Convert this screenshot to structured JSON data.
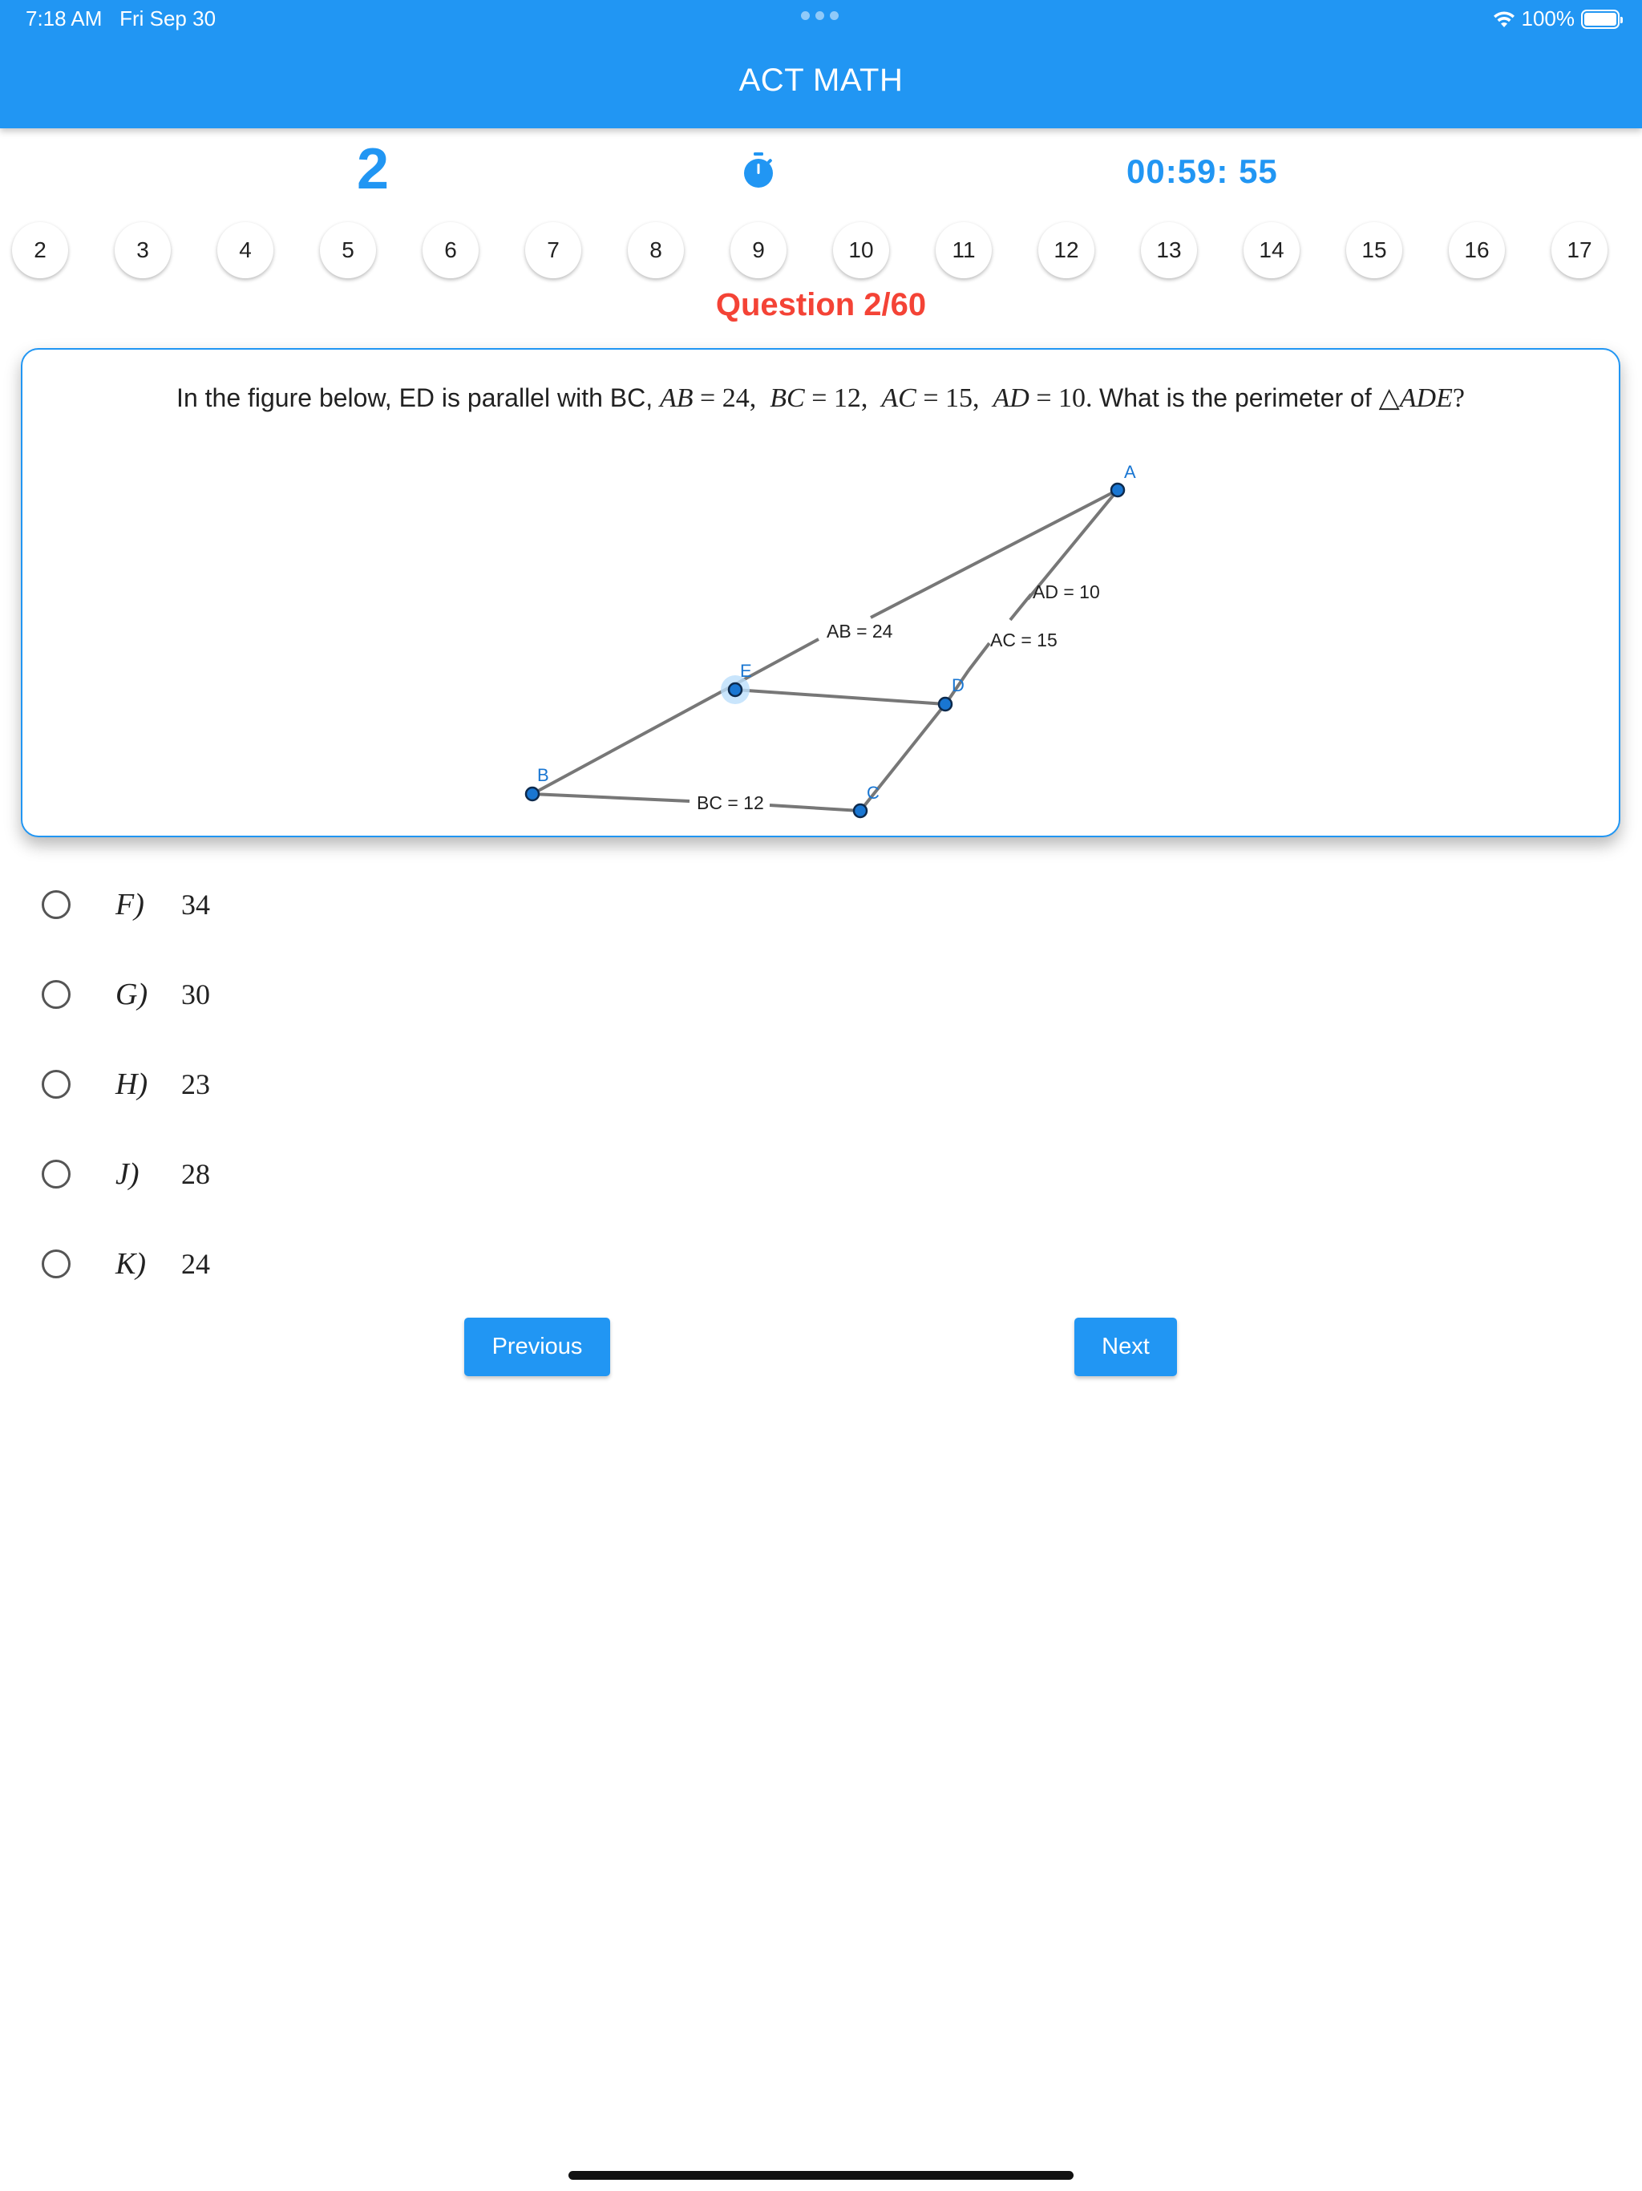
{
  "status_bar": {
    "time": "7:18 AM",
    "date": "Fri Sep 30",
    "battery": "100%"
  },
  "app": {
    "title": "ACT MATH",
    "score": "2",
    "timer": "00:59: 55",
    "accent": "#2196F3",
    "question_label_color": "#F44336"
  },
  "question_strip": [
    "2",
    "3",
    "4",
    "5",
    "6",
    "7",
    "8",
    "9",
    "10",
    "11",
    "12",
    "13",
    "14",
    "15",
    "16",
    "17"
  ],
  "question": {
    "label": "Question 2/60",
    "text_before": "In the figure below, ED is parallel with BC,",
    "math": {
      "ab": "AB",
      "ab_val": "24",
      "bc": "BC",
      "bc_val": "12",
      "ac": "AC",
      "ac_val": "15",
      "ad": "AD",
      "ad_val": "10",
      "tri": "ADE"
    },
    "text_after": "What is the perimeter of",
    "text_end": "?"
  },
  "figure": {
    "points": {
      "a": "A",
      "b": "B",
      "c": "C",
      "d": "D",
      "e": "E"
    },
    "labels": {
      "ab": "AB = 24",
      "bc": "BC = 12",
      "ac": "AC = 15",
      "ad": "AD = 10"
    }
  },
  "answers": [
    {
      "letter": "F)",
      "value": "34"
    },
    {
      "letter": "G)",
      "value": "30"
    },
    {
      "letter": "H)",
      "value": "23"
    },
    {
      "letter": "J)",
      "value": "28"
    },
    {
      "letter": "K)",
      "value": "24"
    }
  ],
  "nav": {
    "previous": "Previous",
    "next": "Next"
  }
}
